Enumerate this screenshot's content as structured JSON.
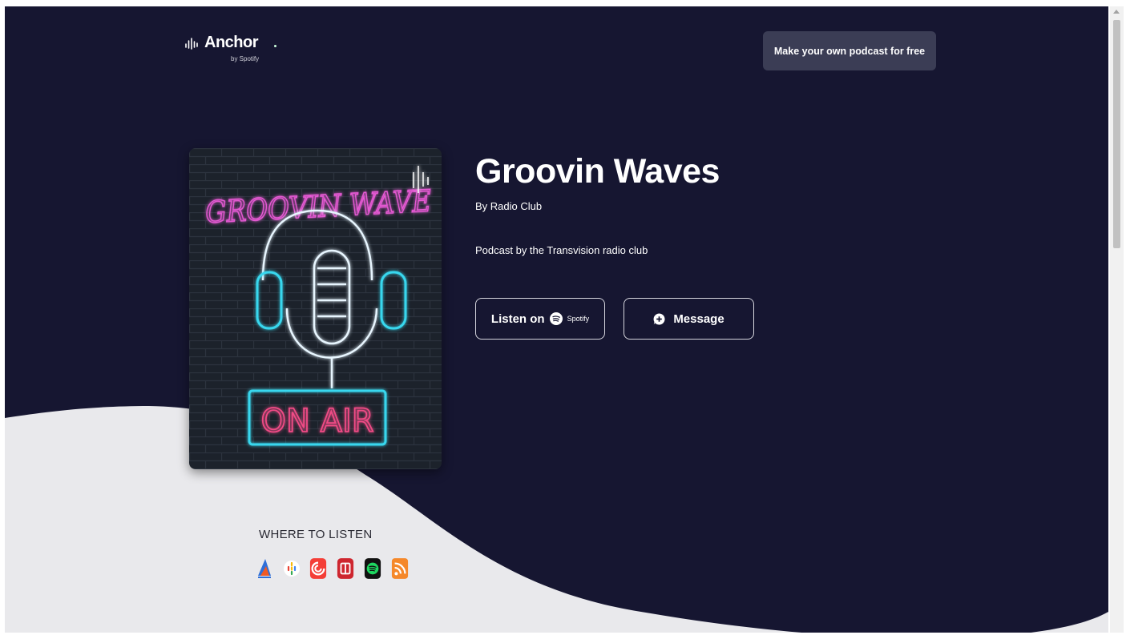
{
  "header": {
    "logo_text": "Anchor",
    "logo_subtext": "by Spotify",
    "cta_label": "Make your own podcast for free"
  },
  "podcast": {
    "title": "Groovin Waves",
    "author": "By Radio Club",
    "description": "Podcast by the Transvision radio club",
    "cover_art": {
      "top_text": "GROOVIN WAVE",
      "bottom_text": "ON AIR"
    }
  },
  "actions": {
    "listen_label": "Listen on",
    "listen_brand": "Spotify",
    "message_label": "Message"
  },
  "where_to_listen": {
    "heading": "WHERE TO LISTEN",
    "platforms": [
      {
        "icon": "breaker-icon",
        "color": "#2f6fd8"
      },
      {
        "icon": "google-podcasts-icon",
        "color": "#f5b400"
      },
      {
        "icon": "pocket-casts-icon",
        "color": "#f43e37"
      },
      {
        "icon": "radio-public-icon",
        "color": "#ce262f"
      },
      {
        "icon": "spotify-icon",
        "color": "#1ed760"
      },
      {
        "icon": "rss-icon",
        "color": "#f5882a"
      }
    ]
  },
  "colors": {
    "hero_background": "#161631",
    "lower_background": "#e9e9ec",
    "cta_background": "#3b3d55",
    "neon_pink": "#e85ad6",
    "neon_cyan": "#38d7ee"
  }
}
